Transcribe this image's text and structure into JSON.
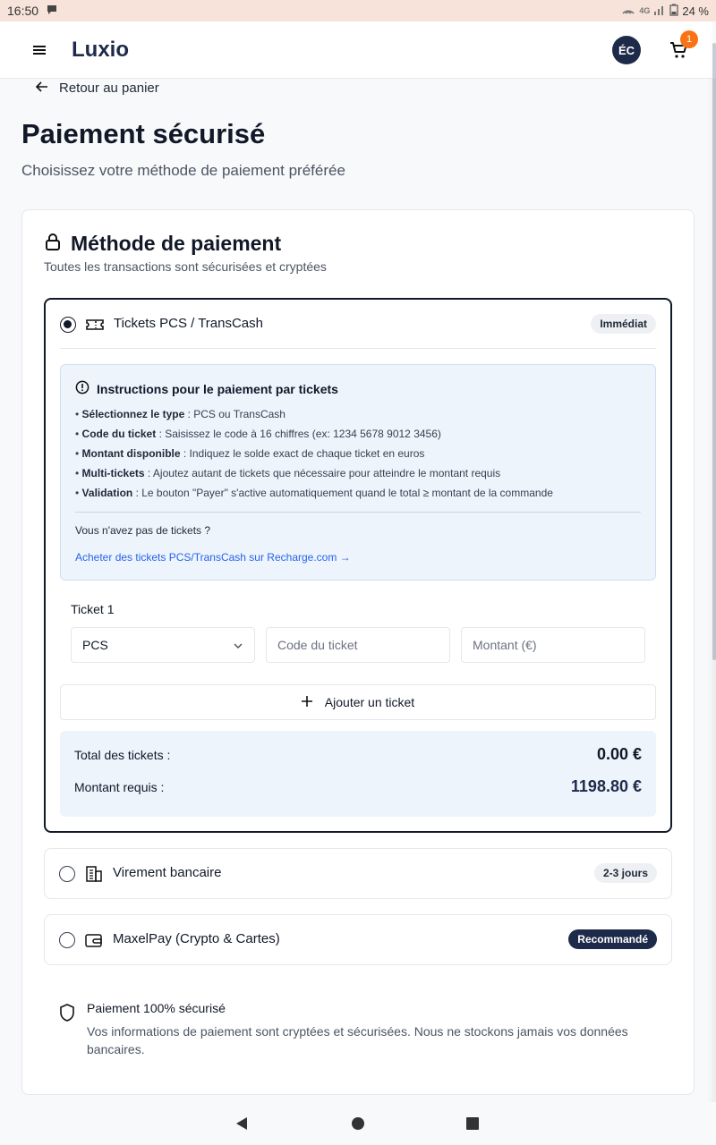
{
  "status_bar": {
    "time": "16:50",
    "network": "4G",
    "battery": "24 %"
  },
  "header": {
    "brand": "Luxio",
    "avatar_initials": "ÉC",
    "cart_count": "1"
  },
  "back_link": "Retour au panier",
  "page": {
    "title": "Paiement sécurisé",
    "subtitle": "Choisissez votre méthode de paiement préférée"
  },
  "method_card": {
    "title": "Méthode de paiement",
    "subtitle": "Toutes les transactions sont sécurisées et cryptées"
  },
  "options": {
    "pcs": {
      "label": "Tickets PCS / TransCash",
      "badge": "Immédiat",
      "selected": true
    },
    "virement": {
      "label": "Virement bancaire",
      "badge": "2-3 jours",
      "selected": false
    },
    "maxelpay": {
      "label": "MaxelPay (Crypto & Cartes)",
      "badge": "Recommandé",
      "selected": false
    }
  },
  "instructions": {
    "title": "Instructions pour le paiement par tickets",
    "items": [
      {
        "key": "Sélectionnez le type",
        "text": " : PCS ou TransCash"
      },
      {
        "key": "Code du ticket",
        "text": " : Saisissez le code à 16 chiffres (ex: 1234 5678 9012 3456)"
      },
      {
        "key": "Montant disponible",
        "text": " : Indiquez le solde exact de chaque ticket en euros"
      },
      {
        "key": "Multi-tickets",
        "text": " : Ajoutez autant de tickets que nécessaire pour atteindre le montant requis"
      },
      {
        "key": "Validation",
        "text": " : Le bouton \"Payer\" s'active automatiquement quand le total ≥ montant de la commande"
      }
    ],
    "no_tickets": "Vous n'avez pas de tickets ?",
    "buy_link": "Acheter des tickets PCS/TransCash sur Recharge.com →"
  },
  "ticket": {
    "label": "Ticket 1",
    "type_value": "PCS",
    "code_placeholder": "Code du ticket",
    "amount_placeholder": "Montant (€)"
  },
  "add_ticket": "Ajouter un ticket",
  "totals": {
    "total_label": "Total des tickets :",
    "total_value": "0.00 €",
    "required_label": "Montant requis :",
    "required_value": "1198.80 €"
  },
  "secure_note": {
    "title": "Paiement 100% sécurisé",
    "text": "Vos informations de paiement sont cryptées et sécurisées. Nous ne stockons jamais vos données bancaires."
  },
  "colors": {
    "brand_navy": "#1e2a4a",
    "badge_orange": "#f97316",
    "link_blue": "#2563eb",
    "info_bg": "#eef4fc"
  }
}
